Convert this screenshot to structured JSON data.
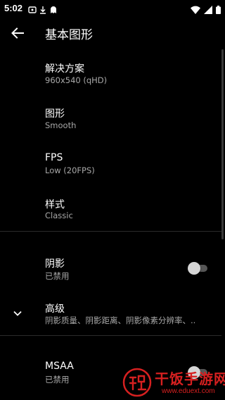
{
  "status_bar": {
    "time": "5:02"
  },
  "app_bar": {
    "title": "基本图形"
  },
  "prefs": {
    "resolution": {
      "title": "解决方案",
      "summary": "960x540 (qHD)"
    },
    "graphics": {
      "title": "图形",
      "summary": "Smooth"
    },
    "fps": {
      "title": "FPS",
      "summary": "Low (20FPS)"
    },
    "style": {
      "title": "样式",
      "summary": "Classic"
    },
    "shadow": {
      "title": "阴影",
      "summary": "已禁用",
      "enabled": false
    },
    "advanced": {
      "title": "高级",
      "summary": "阴影质量、阴影距离、阴影像素分辨率、.."
    },
    "msaa": {
      "title": "MSAA",
      "summary": "已禁用",
      "enabled": false
    }
  },
  "watermark": {
    "title": "干饭手游网",
    "url": "www.eduext.com",
    "color": "#d62020"
  }
}
